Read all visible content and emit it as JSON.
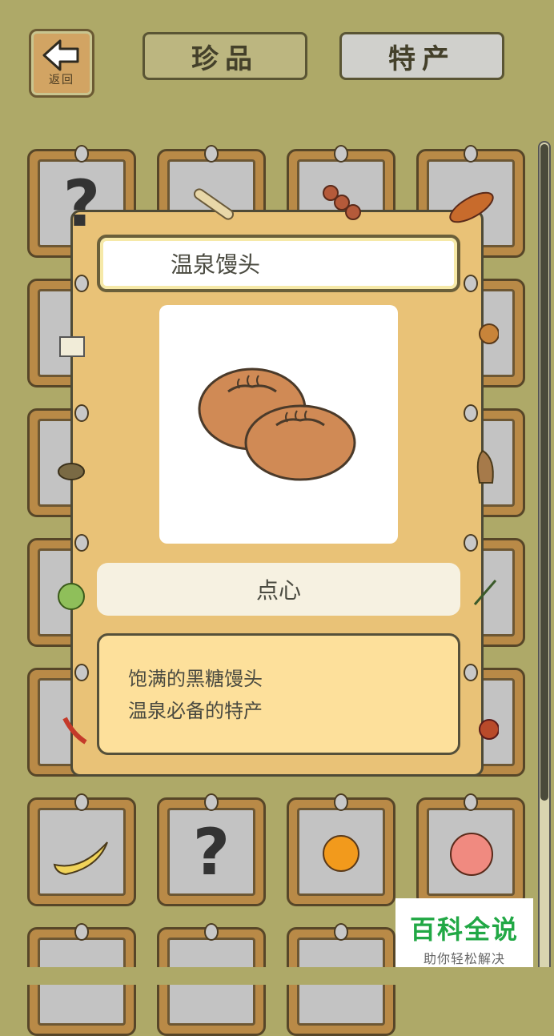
{
  "header": {
    "back_label": "返回",
    "tabs": [
      {
        "label": "珍品"
      },
      {
        "label": "特产"
      }
    ]
  },
  "modal": {
    "item_name": "温泉馒头",
    "category": "点心",
    "description_lines": [
      "饱满的黑糖馒头",
      "温泉必备的特产"
    ]
  },
  "grid": {
    "unknown_mark": "?"
  },
  "watermark": {
    "title": "百科全说",
    "subtitle": "助你轻松解决"
  },
  "colors": {
    "background": "#aea968",
    "modal": "#e9c277",
    "accent_green": "#21a845"
  }
}
